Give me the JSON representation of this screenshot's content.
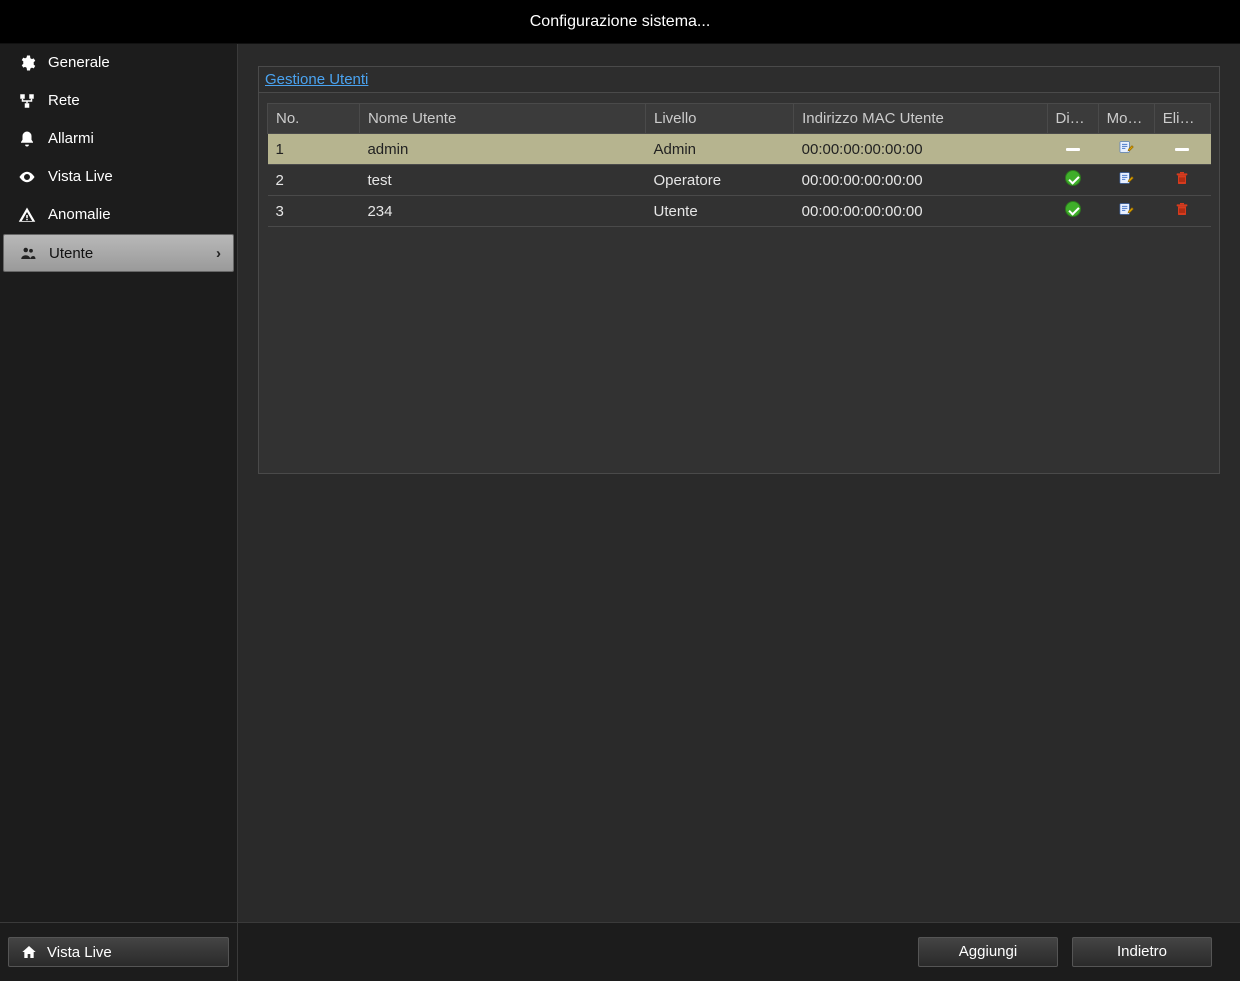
{
  "window": {
    "title": "Configurazione sistema..."
  },
  "sidebar": {
    "items": [
      {
        "label": "Generale",
        "icon": "gear-icon",
        "active": false
      },
      {
        "label": "Rete",
        "icon": "network-icon",
        "active": false
      },
      {
        "label": "Allarmi",
        "icon": "bell-icon",
        "active": false
      },
      {
        "label": "Vista Live",
        "icon": "eye-icon",
        "active": false
      },
      {
        "label": "Anomalie",
        "icon": "warning-icon",
        "active": false
      },
      {
        "label": "Utente",
        "icon": "users-icon",
        "active": true
      }
    ]
  },
  "panel": {
    "title": "Gestione Utenti"
  },
  "table": {
    "headers": {
      "no": "No.",
      "username": "Nome Utente",
      "level": "Livello",
      "mac": "Indirizzo MAC Utente",
      "rights": "Diritti",
      "modify": "Mod...",
      "delete": "Elimi..."
    },
    "rows": [
      {
        "no": "1",
        "username": "admin",
        "level": "Admin",
        "mac": "00:00:00:00:00:00",
        "rights": "dash",
        "modify": "edit",
        "delete": "dash",
        "selected": true
      },
      {
        "no": "2",
        "username": "test",
        "level": "Operatore",
        "mac": "00:00:00:00:00:00",
        "rights": "check",
        "modify": "edit",
        "delete": "trash",
        "selected": false
      },
      {
        "no": "3",
        "username": "234",
        "level": "Utente",
        "mac": "00:00:00:00:00:00",
        "rights": "check",
        "modify": "edit",
        "delete": "trash",
        "selected": false
      }
    ]
  },
  "footer": {
    "live_label": "Vista Live",
    "add_label": "Aggiungi",
    "back_label": "Indietro"
  }
}
